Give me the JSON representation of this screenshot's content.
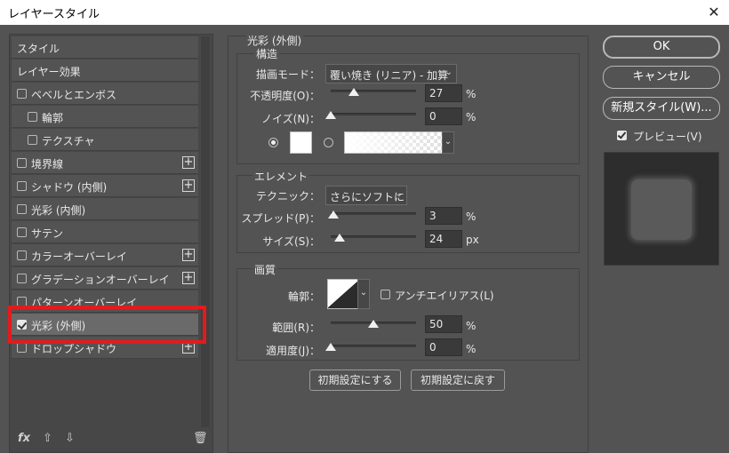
{
  "window": {
    "title": "レイヤースタイル",
    "close_glyph": "✕"
  },
  "left_panel": {
    "items": [
      {
        "label": "スタイル",
        "checkbox": false,
        "plus": false,
        "indent": 0
      },
      {
        "label": "レイヤー効果",
        "checkbox": false,
        "plus": false,
        "indent": 0
      },
      {
        "label": "ベベルとエンボス",
        "checkbox": true,
        "checked": false,
        "plus": false,
        "indent": 0
      },
      {
        "label": "輪郭",
        "checkbox": true,
        "checked": false,
        "plus": false,
        "indent": 1
      },
      {
        "label": "テクスチャ",
        "checkbox": true,
        "checked": false,
        "plus": false,
        "indent": 1
      },
      {
        "label": "境界線",
        "checkbox": true,
        "checked": false,
        "plus": true,
        "indent": 0
      },
      {
        "label": "シャドウ (内側)",
        "checkbox": true,
        "checked": false,
        "plus": true,
        "indent": 0
      },
      {
        "label": "光彩 (内側)",
        "checkbox": true,
        "checked": false,
        "plus": false,
        "indent": 0
      },
      {
        "label": "サテン",
        "checkbox": true,
        "checked": false,
        "plus": false,
        "indent": 0
      },
      {
        "label": "カラーオーバーレイ",
        "checkbox": true,
        "checked": false,
        "plus": true,
        "indent": 0
      },
      {
        "label": "グラデーションオーバーレイ",
        "checkbox": true,
        "checked": false,
        "plus": true,
        "indent": 0
      },
      {
        "label": "パターンオーバーレイ",
        "checkbox": true,
        "checked": false,
        "plus": false,
        "indent": 0
      },
      {
        "label": "光彩 (外側)",
        "checkbox": true,
        "checked": true,
        "plus": false,
        "indent": 0,
        "selected": true
      },
      {
        "label": "ドロップシャドウ",
        "checkbox": true,
        "checked": false,
        "plus": true,
        "indent": 0
      }
    ],
    "bottom": {
      "fx": "fx",
      "up": "⇧",
      "down": "⇩",
      "trash": "🗑"
    },
    "highlight_color": "#e31b1b"
  },
  "outer_glow": {
    "section_title": "光彩 (外側)",
    "structure": {
      "title": "構造",
      "blend_mode": {
        "label": "描画モード：",
        "value": "覆い焼き (リニア) - 加算"
      },
      "opacity": {
        "label": "不透明度(O)：",
        "value": "27",
        "unit": "%",
        "fraction": 0.27
      },
      "noise": {
        "label": "ノイズ(N)：",
        "value": "0",
        "unit": "%",
        "fraction": 0.0
      },
      "color": "#ffffff"
    },
    "elements": {
      "title": "エレメント",
      "technique": {
        "label": "テクニック：",
        "value": "さらにソフトに"
      },
      "spread": {
        "label": "スプレッド(P)：",
        "value": "3",
        "unit": "%",
        "fraction": 0.03
      },
      "size": {
        "label": "サイズ(S)：",
        "value": "24",
        "unit": "px",
        "fraction": 0.1
      }
    },
    "quality": {
      "title": "画質",
      "contour": {
        "label": "輪郭："
      },
      "antialias": {
        "label": "アンチエイリアス(L)",
        "checked": false
      },
      "range": {
        "label": "範囲(R)：",
        "value": "50",
        "unit": "%",
        "fraction": 0.5
      },
      "jitter": {
        "label": "適用度(J)：",
        "value": "0",
        "unit": "%",
        "fraction": 0.0
      }
    },
    "buttons": {
      "make_default": "初期設定にする",
      "reset_default": "初期設定に戻す"
    }
  },
  "right_panel": {
    "ok": "OK",
    "cancel": "キャンセル",
    "new_style": "新規スタイル(W)...",
    "preview": {
      "label": "プレビュー(V)",
      "checked": true
    }
  }
}
